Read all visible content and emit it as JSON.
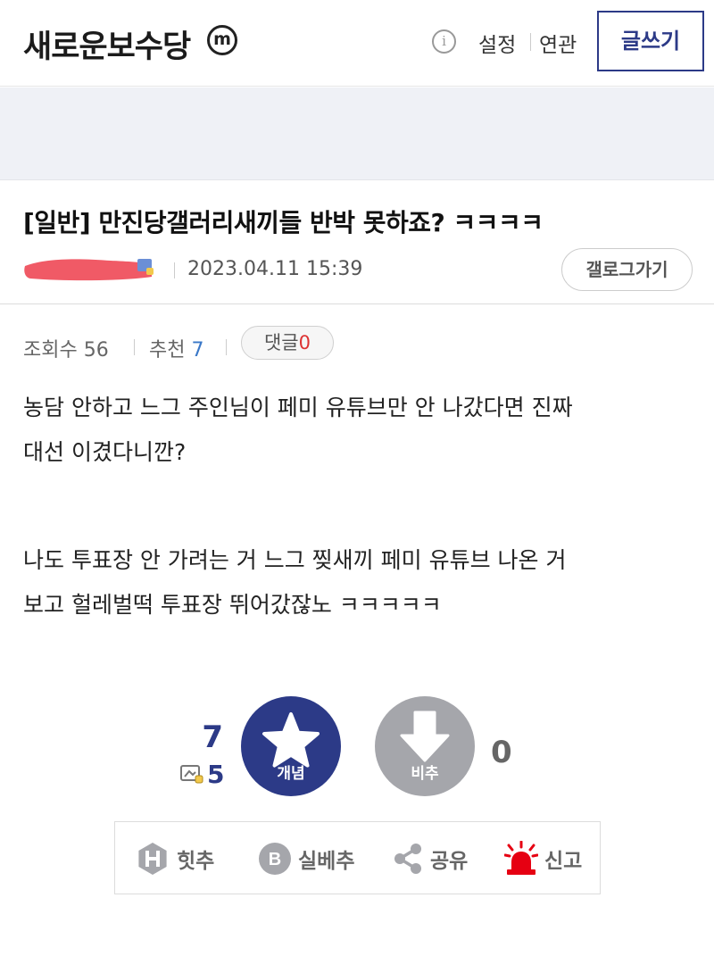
{
  "header": {
    "gallery_name": "새로운보수당",
    "minor_badge": "m",
    "info_icon": "i",
    "settings_label": "설정",
    "related_label": "연관",
    "write_label": "글쓰기"
  },
  "post": {
    "title": "[일반] 만진당갤러리새끼들 반박 못하죠? ㅋㅋㅋㅋ",
    "date": "2023.04.11 15:39",
    "gallog_label": "갤로그가기",
    "views_label": "조회수",
    "views": "56",
    "recommend_label": "추천",
    "recommend": "7",
    "comments_label": "댓글",
    "comments": "0",
    "body": [
      "농담 안하고 느그 주인님이 페미 유튜브만 안 나갔다면 진짜",
      "대선 이겼다니깐?",
      "",
      "나도 투표장 안 가려는 거 느그 찢새끼 페미 유튜브 나온 거",
      "보고 헐레벌떡 투표장 뛰어갔잖노 ㅋㅋㅋㅋㅋ"
    ]
  },
  "vote": {
    "up_count": "7",
    "fixed_count": "5",
    "up_label": "개념",
    "down_label": "비추",
    "down_count": "0"
  },
  "actions": {
    "hit_label": "힛추",
    "b_label": "실베추",
    "share_label": "공유",
    "report_label": "신고"
  },
  "colors": {
    "accent": "#2c3a87",
    "downvote": "#a5a6ab",
    "report": "#e60012",
    "recommend_num": "#3a78c8",
    "comment_num": "#dd3333",
    "redaction": "#f05a66"
  }
}
